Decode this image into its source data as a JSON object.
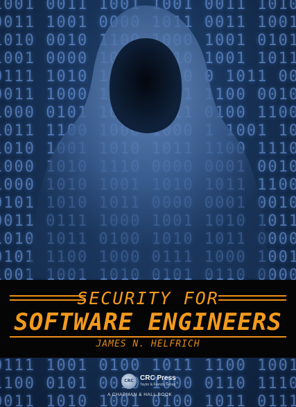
{
  "cover": {
    "title_line1": "SECURITY FOR",
    "title_line2": "SOFTWARE ENGINEERS",
    "author": "JAMES N. HELFRICH"
  },
  "publisher": {
    "logo_text": "CRC",
    "name": "CRC Press",
    "subtitle": "Taylor & Francis Group",
    "imprint": "A CHAPMAN & HALL BOOK"
  },
  "background": {
    "binary_rows": [
      "1001 0011 1001 1001 0011 1010",
      "0011 1001 0000 1011 0011 1001",
      "1010 0010 1100 1000 1001 0101",
      "1001 0000 1001 0010 1001 1011",
      "0111 1010 1001 0110 0 1011 000",
      "0011 1000 1010 1011 1100 0010",
      "1000 0101 1010 0011 0100 1100",
      "1011 1100 1000 1000 1 1001 1010",
      "1010 1001 1010 1011 1100 1110",
      "1000 1010 1110 0000 0001 0010 0011",
      "1000 1010 1001 1010 1011 1100",
      "0101 1010 1011 0000 0001 0010",
      "0011 0111 1000 1001 1010 1011",
      "1010 1011 0100 1010 1011 0000",
      "0101 1100 1000 0111 1000 1001",
      "1001 1001 1010 0101 0110 0000",
      "0111 0011 1000 1100 1010 0011",
      "0110 1000 0101 1011 1000 0001",
      "1001 0111 1010 1011 1011 0001",
      "1010 0001 1011 0000 1000 0110",
      "0111 1001 0100 1011 1100 1001",
      "1100 0101 0010 1000 0110 1110",
      "0011 1010 1001 0100 1011 0111"
    ],
    "colors": {
      "band": "#050505",
      "title": "#f39a1d",
      "binary": "#7fb0ff"
    }
  }
}
